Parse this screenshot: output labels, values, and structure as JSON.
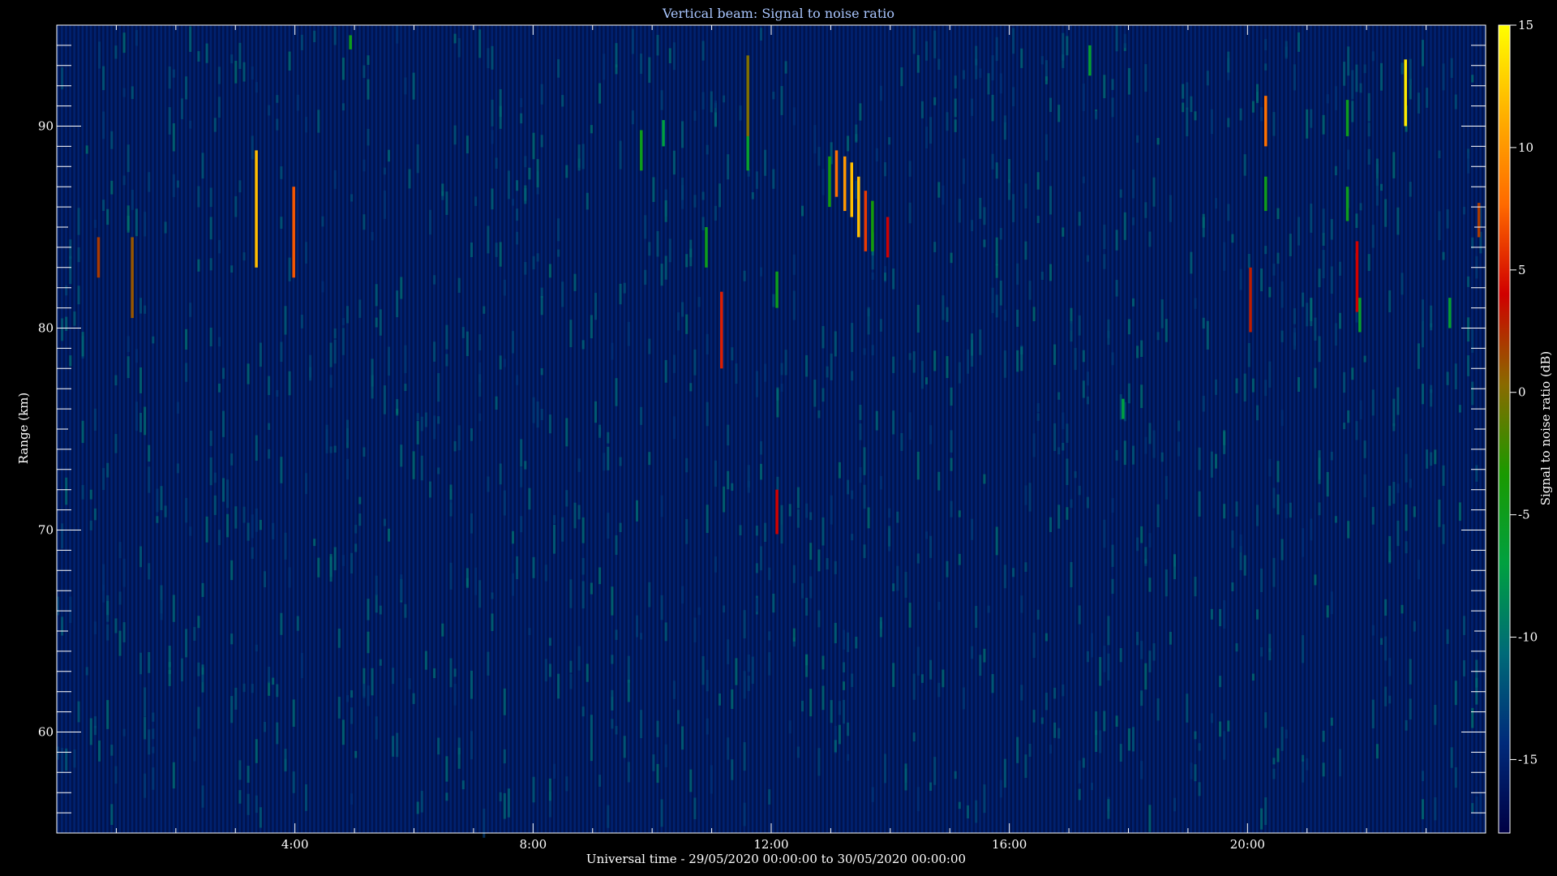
{
  "chart_data": {
    "type": "heatmap",
    "title": "Vertical beam: Signal to noise ratio",
    "xlabel": "Universal time - 29/05/2020 00:00:00 to 30/05/2020 00:00:00",
    "ylabel": "Range (km)",
    "colorbar_label": "Signal to noise ratio (dB)",
    "x_unit": "hours UT",
    "xlim": [
      0,
      24
    ],
    "ylim": [
      55,
      95
    ],
    "clim": [
      -18,
      15
    ],
    "x_ticks": [
      {
        "value": 4,
        "label": "4:00"
      },
      {
        "value": 8,
        "label": "8:00"
      },
      {
        "value": 12,
        "label": "12:00"
      },
      {
        "value": 16,
        "label": "16:00"
      },
      {
        "value": 20,
        "label": "20:00"
      }
    ],
    "y_ticks": [
      {
        "value": 60,
        "label": "60"
      },
      {
        "value": 70,
        "label": "70"
      },
      {
        "value": 80,
        "label": "80"
      },
      {
        "value": 90,
        "label": "90"
      }
    ],
    "colorbar_ticks": [
      {
        "value": 15,
        "label": "15"
      },
      {
        "value": 10,
        "label": "10"
      },
      {
        "value": 5,
        "label": "5"
      },
      {
        "value": 0,
        "label": "0"
      },
      {
        "value": -5,
        "label": "-5"
      },
      {
        "value": -10,
        "label": "-10"
      },
      {
        "value": -15,
        "label": "-15"
      }
    ],
    "background_snr": -15,
    "colormap": [
      "#000044",
      "#002a7a",
      "#006a78",
      "#00a040",
      "#1a9a00",
      "#8a6a00",
      "#d00000",
      "#ff6a00",
      "#ffb000",
      "#ffff00"
    ],
    "echoes": [
      {
        "t": 1.5,
        "r0": 82.5,
        "r1": 84.5,
        "snr": 2
      },
      {
        "t": 2.72,
        "r0": 80.5,
        "r1": 84.5,
        "snr": 1
      },
      {
        "t": 7.2,
        "r0": 83.0,
        "r1": 88.8,
        "snr": 12
      },
      {
        "t": 8.55,
        "r0": 82.5,
        "r1": 87.0,
        "snr": 7
      },
      {
        "t": 10.6,
        "r0": 93.8,
        "r1": 94.5,
        "snr": -5
      },
      {
        "t": 21.1,
        "r0": 87.8,
        "r1": 89.8,
        "snr": -5
      },
      {
        "t": 21.9,
        "r0": 89.0,
        "r1": 90.3,
        "snr": -7
      },
      {
        "t": 23.45,
        "r0": 83.0,
        "r1": 85.0,
        "snr": -5
      },
      {
        "t": 24.0,
        "r0": 78.0,
        "r1": 81.8,
        "snr": 5
      },
      {
        "t": 24.95,
        "r0": 89.5,
        "r1": 93.5,
        "snr": 0
      },
      {
        "t": 24.95,
        "r0": 87.8,
        "r1": 89.5,
        "snr": -6
      },
      {
        "t": 26.0,
        "r0": 69.8,
        "r1": 72.0,
        "snr": 4
      },
      {
        "t": 26.0,
        "r0": 81.0,
        "r1": 82.8,
        "snr": -5
      },
      {
        "t": 27.9,
        "r0": 86.0,
        "r1": 88.5,
        "snr": -4
      },
      {
        "t": 28.15,
        "r0": 86.5,
        "r1": 88.8,
        "snr": 8
      },
      {
        "t": 28.45,
        "r0": 85.8,
        "r1": 88.5,
        "snr": 10
      },
      {
        "t": 28.7,
        "r0": 85.5,
        "r1": 88.2,
        "snr": 12
      },
      {
        "t": 28.95,
        "r0": 84.5,
        "r1": 87.5,
        "snr": 12
      },
      {
        "t": 29.2,
        "r0": 83.8,
        "r1": 86.8,
        "snr": 6
      },
      {
        "t": 29.45,
        "r0": 83.8,
        "r1": 86.3,
        "snr": -4
      },
      {
        "t": 30.0,
        "r0": 83.5,
        "r1": 85.5,
        "snr": 4
      },
      {
        "t": 37.3,
        "r0": 92.5,
        "r1": 94.0,
        "snr": -6
      },
      {
        "t": 38.5,
        "r0": 75.5,
        "r1": 76.5,
        "snr": -7
      },
      {
        "t": 43.1,
        "r0": 79.8,
        "r1": 83.0,
        "snr": 3
      },
      {
        "t": 43.65,
        "r0": 89.0,
        "r1": 91.5,
        "snr": 8
      },
      {
        "t": 43.65,
        "r0": 85.8,
        "r1": 87.5,
        "snr": -5
      },
      {
        "t": 46.6,
        "r0": 89.5,
        "r1": 91.3,
        "snr": -5
      },
      {
        "t": 46.6,
        "r0": 85.3,
        "r1": 87.0,
        "snr": -5
      },
      {
        "t": 46.95,
        "r0": 80.8,
        "r1": 84.3,
        "snr": 4
      },
      {
        "t": 47.05,
        "r0": 79.8,
        "r1": 81.5,
        "snr": -6
      },
      {
        "t": 48.7,
        "r0": 90.0,
        "r1": 93.3,
        "snr": 14
      },
      {
        "t": 50.3,
        "r0": 80.0,
        "r1": 81.5,
        "snr": -6
      },
      {
        "t": 51.35,
        "r0": 84.5,
        "r1": 86.2,
        "snr": 2
      }
    ]
  }
}
